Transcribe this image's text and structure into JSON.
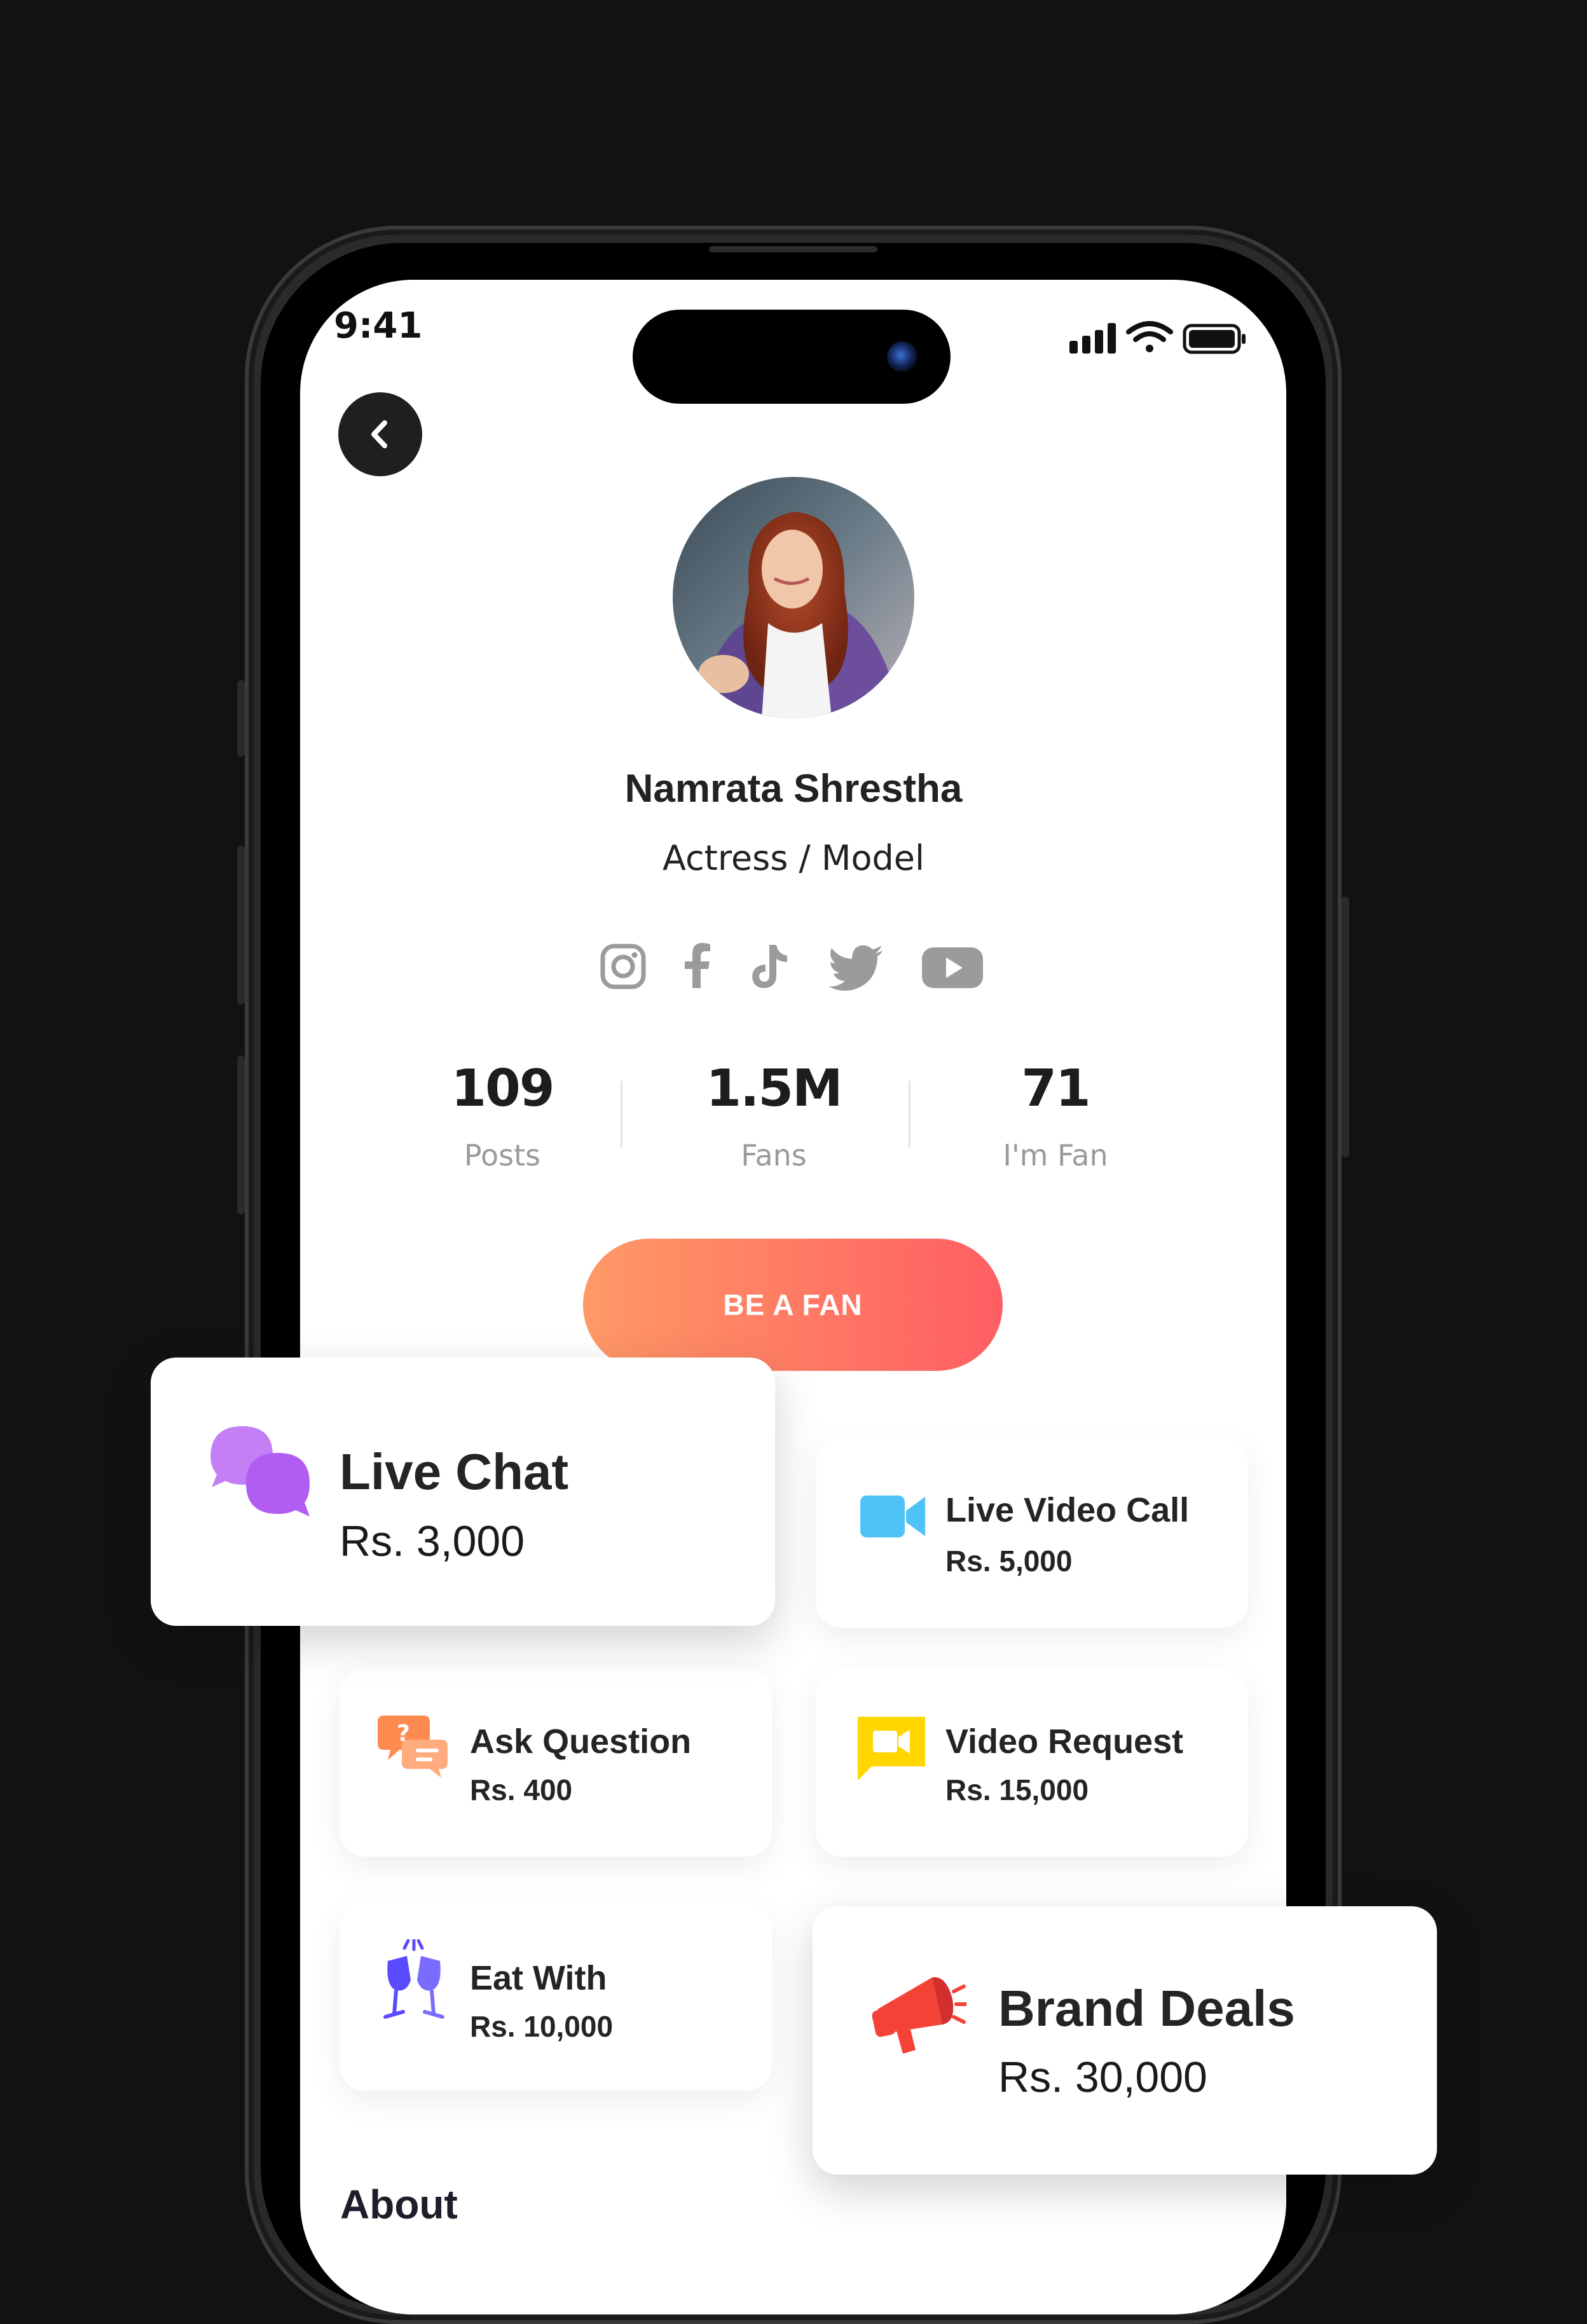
{
  "status_bar": {
    "time": "9:41",
    "icons": [
      "signal-icon",
      "wifi-icon",
      "battery-icon"
    ]
  },
  "profile": {
    "name": "Namrata Shrestha",
    "role": "Actress / Model",
    "avatar": "profile-photo",
    "socials": [
      "instagram-icon",
      "facebook-icon",
      "tiktok-icon",
      "twitter-icon",
      "youtube-icon"
    ]
  },
  "stats": [
    {
      "value": "109",
      "label": "Posts"
    },
    {
      "value": "1.5M",
      "label": "Fans"
    },
    {
      "value": "71",
      "label": "I'm Fan"
    }
  ],
  "cta": {
    "label": "BE A FAN"
  },
  "services": [
    {
      "title": "Live Chat",
      "price": "Rs.  3,000",
      "icon": "chat-bubbles-icon",
      "color": "#b15cf2"
    },
    {
      "title": "Live Video Call",
      "price": "Rs.  5,000",
      "icon": "video-camera-icon",
      "color": "#4fc3f7"
    },
    {
      "title": "Ask Question",
      "price": "Rs.  400",
      "icon": "question-chat-icon",
      "color": "#ff8a50"
    },
    {
      "title": "Video Request",
      "price": "Rs.  15,000",
      "icon": "video-message-icon",
      "color": "#ffd600"
    },
    {
      "title": "Eat With",
      "price": "Rs.  10,000",
      "icon": "cheers-glasses-icon",
      "color": "#5b4bff"
    },
    {
      "title": "Brand Deals",
      "price": "Rs.  30,000",
      "icon": "megaphone-icon",
      "color": "#f44336"
    }
  ],
  "about": {
    "heading": "About"
  },
  "colors": {
    "background": "#121212",
    "cta_gradient_start": "#ff9966",
    "cta_gradient_end": "#ff5e62"
  }
}
